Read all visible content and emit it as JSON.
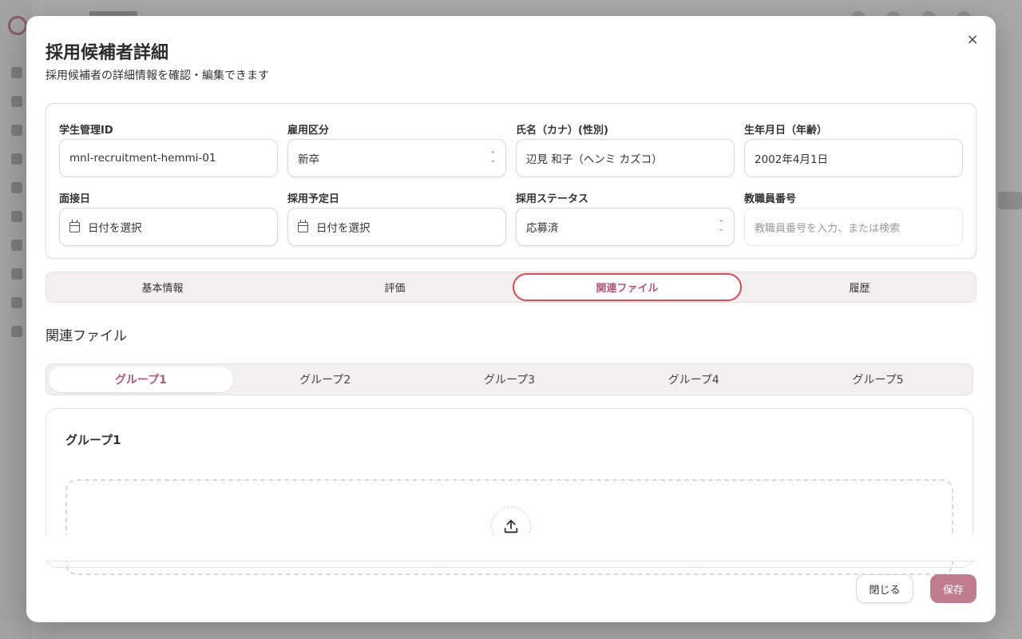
{
  "modal": {
    "title": "採用候補者詳細",
    "subtitle": "採用候補者の詳細情報を確認・編集できます",
    "close_icon": "×"
  },
  "fields": {
    "student_id": {
      "label": "学生管理ID",
      "value": "mnl-recruitment-hemmi-01"
    },
    "employment_type": {
      "label": "雇用区分",
      "value": "新卒"
    },
    "name": {
      "label": "氏名（カナ）(性別)",
      "value": "辺見 和子（ヘンミ カズコ）"
    },
    "birthdate": {
      "label": "生年月日（年齢）",
      "value": "2002年4月1日"
    },
    "interview_date": {
      "label": "面接日",
      "placeholder": "日付を選択"
    },
    "hire_date": {
      "label": "採用予定日",
      "placeholder": "日付を選択"
    },
    "status": {
      "label": "採用ステータス",
      "value": "応募済"
    },
    "staff_number": {
      "label": "教職員番号",
      "placeholder": "教職員番号を入力、または検索"
    }
  },
  "tabs": [
    {
      "label": "基本情報",
      "active": false
    },
    {
      "label": "評価",
      "active": false
    },
    {
      "label": "関連ファイル",
      "active": true
    },
    {
      "label": "履歴",
      "active": false
    }
  ],
  "section": {
    "title": "関連ファイル"
  },
  "group_tabs": [
    {
      "label": "グループ1",
      "active": true
    },
    {
      "label": "グループ2",
      "active": false
    },
    {
      "label": "グループ3",
      "active": false
    },
    {
      "label": "グループ4",
      "active": false
    },
    {
      "label": "グループ5",
      "active": false
    }
  ],
  "group_card": {
    "title": "グループ1",
    "icon": "upload-icon"
  },
  "footer": {
    "close_label": "閉じる",
    "save_label": "保存"
  },
  "colors": {
    "accent": "#b05a76",
    "save_button": "#c07d8f",
    "active_tab_outline": "#d94a52"
  }
}
